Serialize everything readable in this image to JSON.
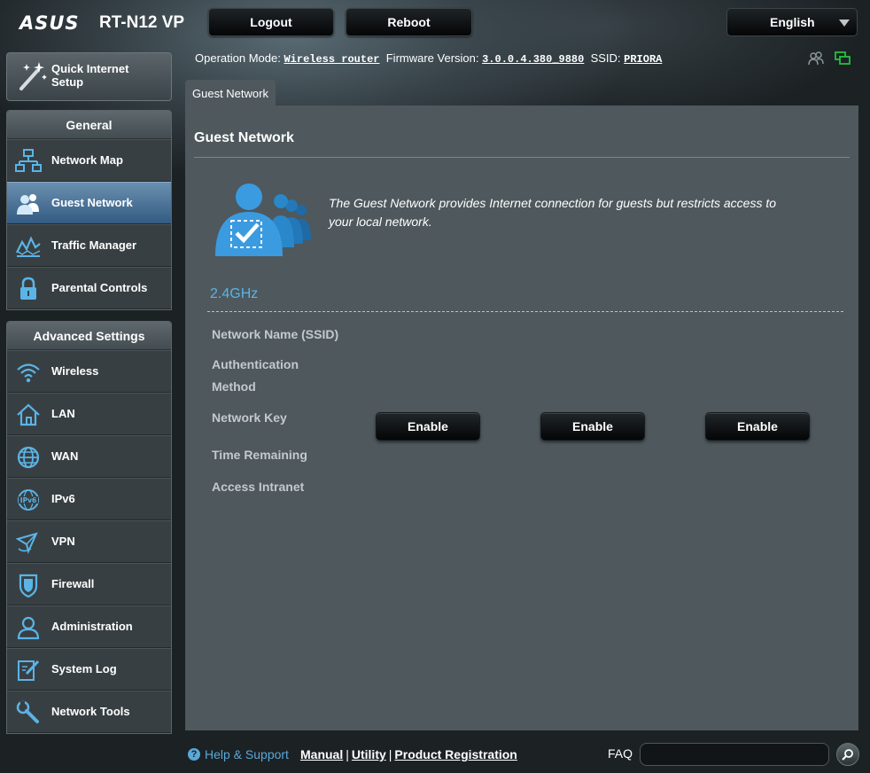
{
  "header": {
    "brand": "ASUS",
    "model": "RT-N12 VP",
    "logout_label": "Logout",
    "reboot_label": "Reboot",
    "language": "English"
  },
  "status": {
    "operation_mode_label": "Operation Mode:",
    "operation_mode_value": "Wireless router",
    "firmware_label": "Firmware Version:",
    "firmware_value": "3.0.0.4.380_9880",
    "ssid_label": "SSID:",
    "ssid_value": "PRIORA"
  },
  "sidebar": {
    "qis_label": "Quick Internet Setup",
    "general_title": "General",
    "general_items": [
      {
        "label": "Network Map"
      },
      {
        "label": "Guest Network"
      },
      {
        "label": "Traffic Manager"
      },
      {
        "label": "Parental Controls"
      }
    ],
    "advanced_title": "Advanced Settings",
    "advanced_items": [
      {
        "label": "Wireless"
      },
      {
        "label": "LAN"
      },
      {
        "label": "WAN"
      },
      {
        "label": "IPv6"
      },
      {
        "label": "VPN"
      },
      {
        "label": "Firewall"
      },
      {
        "label": "Administration"
      },
      {
        "label": "System Log"
      },
      {
        "label": "Network Tools"
      }
    ]
  },
  "content": {
    "tab_label": "Guest Network",
    "title": "Guest Network",
    "description": "The Guest Network provides Internet connection for guests but restricts access to your local network.",
    "band": "2.4GHz",
    "rows": {
      "ssid": "Network Name (SSID)",
      "auth": "Authentication Method",
      "key": "Network Key",
      "time": "Time Remaining",
      "intranet": "Access Intranet"
    },
    "enable_buttons": [
      "Enable",
      "Enable",
      "Enable"
    ]
  },
  "footer": {
    "help_label": "Help & Support",
    "manual": "Manual",
    "utility": "Utility",
    "product_registration": "Product Registration",
    "faq_label": "FAQ",
    "faq_value": ""
  },
  "colors": {
    "accent_blue": "#5ab4e6",
    "active_menu": "#335b82",
    "panel": "#4e585d",
    "status_green": "#22c23a"
  }
}
